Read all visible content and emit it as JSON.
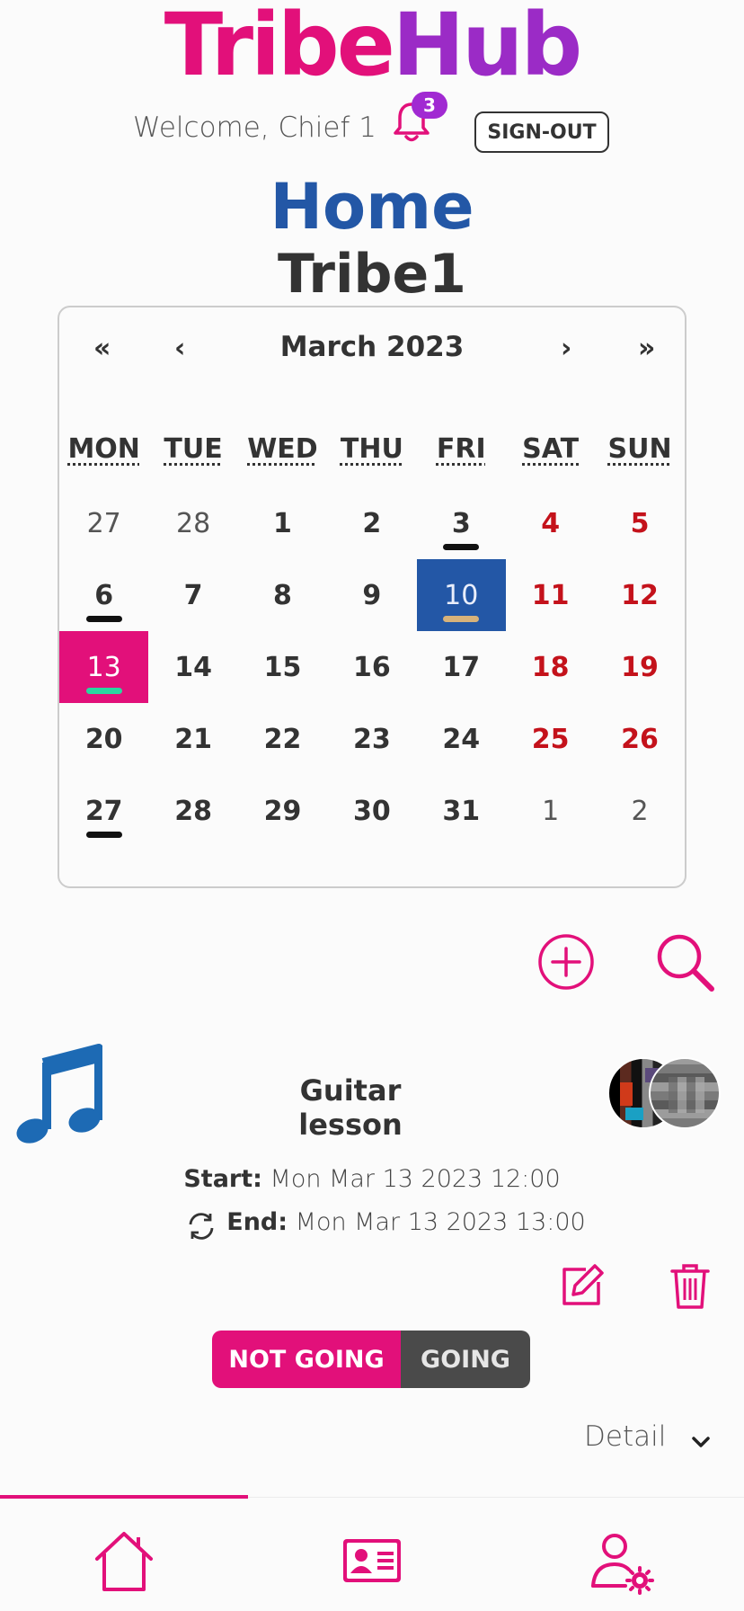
{
  "app": {
    "logo_part1": "Tribe",
    "logo_part2": "Hub",
    "colors": {
      "primary": "#e2107a",
      "accent_purple": "#9b2bc6",
      "blue": "#2357a6",
      "weekend_red": "#c4121b"
    }
  },
  "header": {
    "welcome": "Welcome, Chief 1",
    "notification_count": "3",
    "signout_label": "SIGN-OUT"
  },
  "page": {
    "title": "Home",
    "tribe": "Tribe1"
  },
  "calendar": {
    "nav_first": "«",
    "nav_prev": "‹",
    "nav_next": "›",
    "nav_last": "»",
    "month_label": "March 2023",
    "weekdays": [
      "MON",
      "TUE",
      "WED",
      "THU",
      "FRI",
      "SAT",
      "SUN"
    ],
    "weeks": [
      [
        {
          "d": "27",
          "other": true,
          "dot": false
        },
        {
          "d": "28",
          "other": true,
          "dot": false
        },
        {
          "d": "1",
          "dot": false
        },
        {
          "d": "2",
          "dot": false
        },
        {
          "d": "3",
          "dot": true
        },
        {
          "d": "4",
          "weekend": true,
          "dot": false
        },
        {
          "d": "5",
          "weekend": true,
          "dot": false
        }
      ],
      [
        {
          "d": "6",
          "dot": true
        },
        {
          "d": "7",
          "dot": false
        },
        {
          "d": "8",
          "dot": false
        },
        {
          "d": "9",
          "dot": false
        },
        {
          "d": "10",
          "selected": true,
          "dot": true
        },
        {
          "d": "11",
          "weekend": true,
          "dot": false
        },
        {
          "d": "12",
          "weekend": true,
          "dot": false
        }
      ],
      [
        {
          "d": "13",
          "today": true,
          "dot": true
        },
        {
          "d": "14",
          "dot": false
        },
        {
          "d": "15",
          "dot": false
        },
        {
          "d": "16",
          "dot": false
        },
        {
          "d": "17",
          "dot": false
        },
        {
          "d": "18",
          "weekend": true,
          "dot": false
        },
        {
          "d": "19",
          "weekend": true,
          "dot": false
        }
      ],
      [
        {
          "d": "20",
          "dot": false
        },
        {
          "d": "21",
          "dot": false
        },
        {
          "d": "22",
          "dot": false
        },
        {
          "d": "23",
          "dot": false
        },
        {
          "d": "24",
          "dot": false
        },
        {
          "d": "25",
          "weekend": true,
          "dot": false
        },
        {
          "d": "26",
          "weekend": true,
          "dot": false
        }
      ],
      [
        {
          "d": "27",
          "dot": true
        },
        {
          "d": "28",
          "dot": false
        },
        {
          "d": "29",
          "dot": false
        },
        {
          "d": "30",
          "dot": false
        },
        {
          "d": "31",
          "dot": false
        },
        {
          "d": "1",
          "other": true,
          "dot": false
        },
        {
          "d": "2",
          "other": true,
          "dot": false
        }
      ]
    ]
  },
  "actions": {
    "add_icon": "plus-circle-icon",
    "search_icon": "search-icon"
  },
  "event": {
    "icon": "music-note-icon",
    "title": "Guitar lesson",
    "start_label": "Start:",
    "start_value": "Mon Mar 13 2023 12:00",
    "end_label": "End:",
    "end_value": "Mon Mar 13 2023 13:00",
    "not_going_label": "NOT GOING",
    "going_label": "GOING",
    "detail_label": "Detail"
  },
  "bottom_nav": {
    "items": [
      "home-icon",
      "id-card-icon",
      "user-settings-icon"
    ]
  }
}
